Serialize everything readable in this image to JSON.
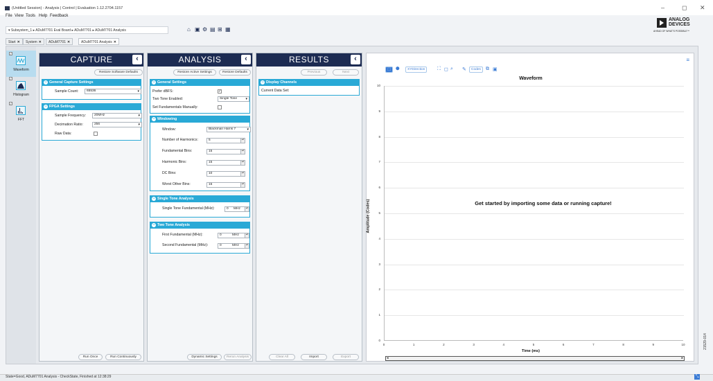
{
  "window": {
    "title": "(Untitled Session) - Analysis | Control | Evaluation 1.12.2704.1157",
    "minimize": "–",
    "maximize": "◻",
    "close": "✕"
  },
  "menu": [
    "File",
    "View",
    "Tools",
    "Help",
    "Feedback"
  ],
  "logo": {
    "line1": "ANALOG",
    "line2": "DEVICES",
    "tagline": "AHEAD OF WHAT'S POSSIBLE™"
  },
  "breadcrumb": "▾ Subsystem_1 ▸ ADuM7701 Eval Board ▸ ADuM7701 ▸ ADuM7701 Analysis",
  "toolbar_icons": [
    "home-icon",
    "save-icon",
    "settings-icon",
    "export-icon",
    "tree-icon",
    "grid-icon"
  ],
  "tabs": [
    {
      "label": "Start",
      "close": "✕"
    },
    {
      "label": "System",
      "close": "✕"
    },
    {
      "label": "ADuM7701",
      "close": "✕"
    },
    {
      "label": "ADuM7701 Analysis",
      "close": "✕"
    }
  ],
  "nav": [
    {
      "label": "Waveform",
      "checked": "✓"
    },
    {
      "label": "Histogram",
      "checked": "✓"
    },
    {
      "label": "FFT",
      "checked": "✓"
    }
  ],
  "capture": {
    "title": "CAPTURE",
    "restore_btn": "Restore Software Defaults",
    "general_title": "General Capture Settings",
    "sample_count_label": "Sample Count:",
    "sample_count_value": "65536",
    "fpga_title": "FPGA Settings",
    "sample_freq_label": "Sample Frequency:",
    "sample_freq_value": "20MHz",
    "decimation_label": "Decimation Ratio:",
    "decimation_value": "256",
    "raw_label": "Raw Data:",
    "run_once": "Run Once",
    "run_cont": "Run Continuously"
  },
  "analysis": {
    "title": "ANALYSIS",
    "restore_active": "Restore Active Settings",
    "restore_defaults": "Restore Defaults",
    "general_title": "General Settings",
    "prefer_dbfs_label": "Prefer dBFS:",
    "prefer_dbfs_check": "✓",
    "two_tone_label": "Two Tone Enabled:",
    "two_tone_value": "Single Tone",
    "set_fund_label": "Set Fundamentals Manually:",
    "windowing_title": "Windowing",
    "window_label": "Window:",
    "window_value": "Blackman Harris 7",
    "harmonics_label": "Number of Harmonics:",
    "harmonics_value": "5",
    "fund_bins_label": "Fundamental Bins:",
    "fund_bins_value": "15",
    "harm_bins_label": "Harmonic Bins:",
    "harm_bins_value": "15",
    "dc_bins_label": "DC Bins:",
    "dc_bins_value": "10",
    "worst_bins_label": "Worst Other Bins:",
    "worst_bins_value": "15",
    "single_tone_title": "Single Tone Analysis",
    "stf_label": "Single Tone Fundamental (MHz):",
    "stf_value": "0",
    "stf_unit": "MHz",
    "two_tone_title": "Two Tone Analysis",
    "ff_label": "First Fundamental (MHz):",
    "ff_value": "0",
    "ff_unit": "MHz",
    "sf_label": "Second Fundamental (MHz):",
    "sf_value": "0",
    "sf_unit": "MHz",
    "dynamic_btn": "Dynamic Settings",
    "rerun_btn": "Rerun Analysis"
  },
  "results": {
    "title": "RESULTS",
    "previous": "Previous",
    "next": "Next",
    "display_title": "Display Channels",
    "current_label": "Current Data Set:",
    "clear_all": "Clear All",
    "import": "Import",
    "export": "Export"
  },
  "chart": {
    "xy_direction": "XYDirection",
    "codes": "Codes",
    "menu": "≡",
    "empty_message": "Get started by importing some data or running capture!"
  },
  "chart_data": {
    "type": "line",
    "title": "Waveform",
    "xlabel": "Time (ms)",
    "ylabel": "Amplitude (Codes)",
    "xlim": [
      0,
      10
    ],
    "ylim": [
      0,
      10
    ],
    "xticks": [
      "0",
      "1",
      "2",
      "3",
      "4",
      "5",
      "6",
      "7",
      "8",
      "9",
      "10"
    ],
    "yticks": [
      "0",
      "1",
      "2",
      "3",
      "4",
      "5",
      "6",
      "7",
      "8",
      "9",
      "10"
    ],
    "series": []
  },
  "status": "State=Good, ADuM7701 Analysis - CheckState, Finished at 12:38:29",
  "figure_id": "21529-014"
}
